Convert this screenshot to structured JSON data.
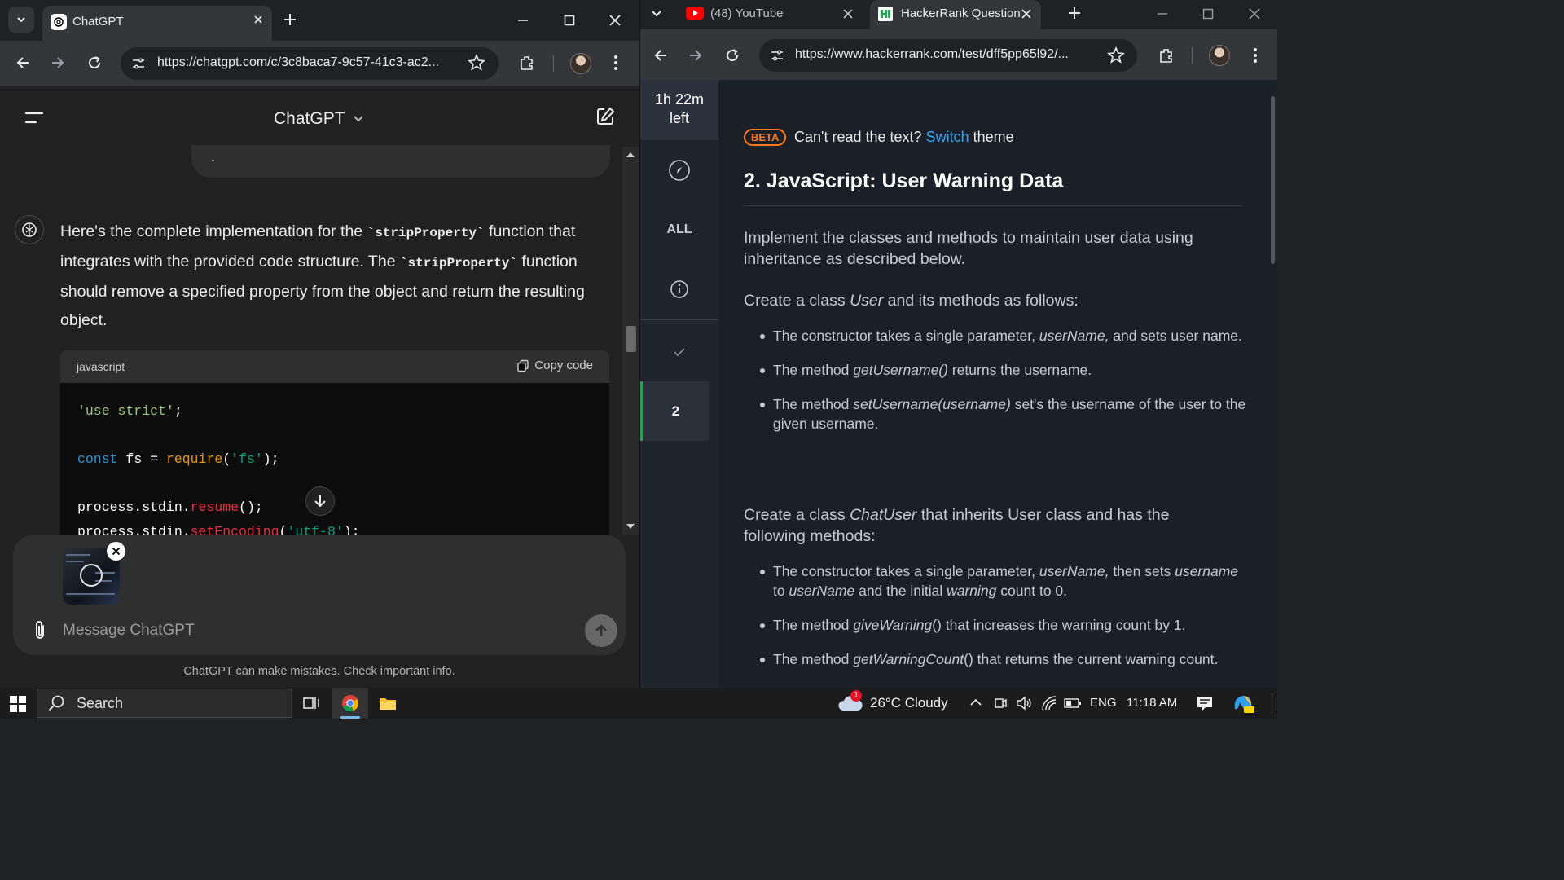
{
  "left_window": {
    "tab_title": "ChatGPT",
    "url": "https://chatgpt.com/c/3c8baca7-9c57-41c3-ac2...",
    "header_title": "ChatGPT",
    "prev_bubble_text": ".",
    "message": {
      "p1": "Here's the complete implementation for the",
      "code1": "`stripProperty`",
      "p2": "function that integrates with the provided code structure. The",
      "code2": "`stripProperty`",
      "p3": "function should remove a specified property from the object and return the resulting object."
    },
    "code_block": {
      "language": "javascript",
      "copy_label": "Copy code",
      "line1_str": "'use strict'",
      "line1_end": ";",
      "line3_kw": "const",
      "line3_mid": " fs = ",
      "line3_fn": "require",
      "line3_open": "(",
      "line3_str": "'fs'",
      "line3_end": ");",
      "line5_obj": "process.stdin.",
      "line5_fn": "resume",
      "line5_end": "();",
      "line6_obj": "process.stdin.",
      "line6_fn": "setEncoding",
      "line6_open": "(",
      "line6_str": "'utf-8'",
      "line6_end": ");"
    },
    "composer_placeholder": "Message ChatGPT",
    "disclaimer": "ChatGPT can make mistakes. Check important info."
  },
  "right_window": {
    "tab1_title": "(48) YouTube",
    "tab2_title": "HackerRank Question",
    "url": "https://www.hackerrank.com/test/dff5pp65l92/...",
    "timer_line1": "1h 22m",
    "timer_line2": "left",
    "side_all": "ALL",
    "side_question_number": "2",
    "beta_badge": "BETA",
    "theme_prompt": "Can't read the text?",
    "theme_link": "Switch",
    "theme_suffix": "theme",
    "question_title": "2. JavaScript: User Warning Data",
    "intro": "Implement the classes and methods to maintain user data using inheritance as described below.",
    "user_class": {
      "pre": "Create a class",
      "name": "User",
      "post": "and its methods as follows:"
    },
    "user_bullets": {
      "b1_pre": "The constructor takes a single parameter,",
      "b1_em": "userName,",
      "b1_post": "and sets user name.",
      "b2_pre": "The method",
      "b2_em": "getUsername()",
      "b2_post": "returns the username.",
      "b3_pre": "The method",
      "b3_em": "setUsername(username)",
      "b3_post": "set's the username of the user to the given username."
    },
    "chatuser_class": {
      "pre": "Create a class",
      "name": "ChatUser",
      "post": "that inherits User class and has the following methods:"
    },
    "chatuser_bullets": {
      "b1_pre": "The constructor takes a single parameter,",
      "b1_em": "userName,",
      "b1_mid1": "then sets",
      "b1_em2": "username",
      "b1_mid2": "to",
      "b1_em3": "userName",
      "b1_mid3": "and the initial",
      "b1_em4": "warning",
      "b1_post": "count to 0.",
      "b2_pre": "The method",
      "b2_em": "giveWarning",
      "b2_post": "() that increases the warning count by 1.",
      "b3_pre": "The method",
      "b3_em": "getWarningCount",
      "b3_post": "() that returns the current warning count."
    }
  },
  "taskbar": {
    "search_label": "Search",
    "weather": "26°C  Cloudy",
    "weather_badge": "1",
    "language": "ENG",
    "time": "11:18 AM"
  },
  "colors": {
    "chatgpt_bg": "#212121",
    "hackerrank_bg": "#1b1f27",
    "accent_link": "#39a6f5",
    "beta_orange": "#ff7a1a",
    "hackerrank_green": "#1ba94c"
  }
}
